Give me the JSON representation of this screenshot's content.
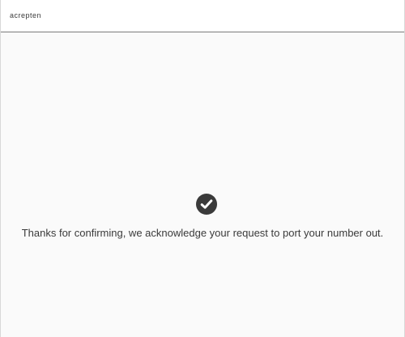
{
  "header": {
    "logo_text": "acrepten"
  },
  "main": {
    "status_icon": "check-circle-icon",
    "message": "Thanks for confirming, we acknowledge your request to port your number out."
  }
}
